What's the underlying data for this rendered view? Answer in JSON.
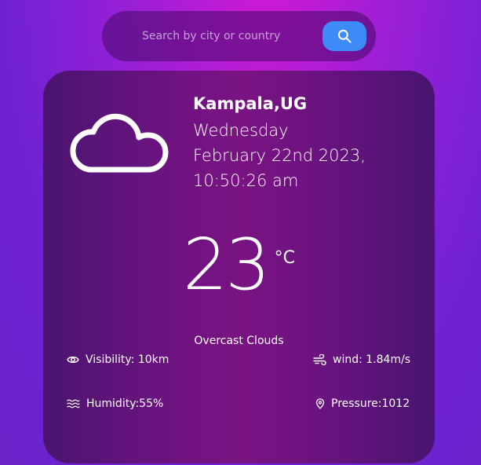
{
  "search": {
    "placeholder": "Search by city or country",
    "icon": "search-icon"
  },
  "weather": {
    "icon": "cloud-icon",
    "location": "Kampala,UG",
    "day": "Wednesday",
    "date": "February 22nd 2023,",
    "time": "10:50:26 am",
    "temperature": "23",
    "unit": "°C",
    "description": "Overcast Clouds"
  },
  "stats": {
    "visibility": "Visibility: 10km",
    "wind": "wind: 1.84m/s",
    "humidity": "Humidity:55%",
    "pressure": "Pressure:1012"
  },
  "colors": {
    "accent_button": "#3d8bf7",
    "card_background": "#6b1380",
    "page_background": "#9b1fd6"
  }
}
